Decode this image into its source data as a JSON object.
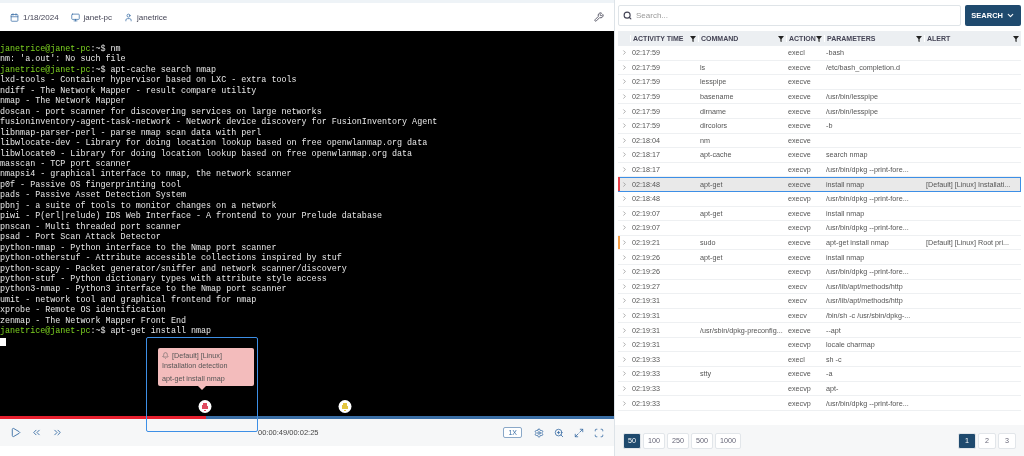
{
  "header": {
    "date": "1/18/2024",
    "host": "janet-pc",
    "user": "janetrice"
  },
  "terminal": {
    "lines": [
      {
        "kind": "prompt",
        "prompt": "janetrice@janet-pc",
        "text": ":~$ nm"
      },
      {
        "kind": "output",
        "text": "nm: 'a.out': No such file"
      },
      {
        "kind": "prompt",
        "prompt": "janetrice@janet-pc",
        "text": ":~$ apt-cache search nmap"
      },
      {
        "kind": "output",
        "text": "lxd-tools - Container hypervisor based on LXC - extra tools"
      },
      {
        "kind": "output",
        "text": "ndiff - The Network Mapper - result compare utility"
      },
      {
        "kind": "output",
        "text": "nmap - The Network Mapper"
      },
      {
        "kind": "output",
        "text": "doscan - port scanner for discovering services on large networks"
      },
      {
        "kind": "output",
        "text": "fusioninventory-agent-task-network - Network device discovery for FusionInventory Agent"
      },
      {
        "kind": "output",
        "text": "libnmap-parser-perl - parse nmap scan data with perl"
      },
      {
        "kind": "output",
        "text": "libwlocate-dev - Library for doing location lookup based on free openwlanmap.org data"
      },
      {
        "kind": "output",
        "text": "libwlocate0 - Library for doing location lookup based on free openwlanmap.org data"
      },
      {
        "kind": "output",
        "text": "masscan - TCP port scanner"
      },
      {
        "kind": "output",
        "text": "nmapsi4 - graphical interface to nmap, the network scanner"
      },
      {
        "kind": "output",
        "text": "p0f - Passive OS fingerprinting tool"
      },
      {
        "kind": "output",
        "text": "pads - Passive Asset Detection System"
      },
      {
        "kind": "output",
        "text": "pbnj - a suite of tools to monitor changes on a network"
      },
      {
        "kind": "output",
        "text": "piwi - P(erl|relude) IDS Web Interface - A frontend to your Prelude database"
      },
      {
        "kind": "output",
        "text": "pnscan - Multi threaded port scanner"
      },
      {
        "kind": "output",
        "text": "psad - Port Scan Attack Detector"
      },
      {
        "kind": "output",
        "text": "python-nmap - Python interface to the Nmap port scanner"
      },
      {
        "kind": "output",
        "text": "python-otherstuf - Attribute accessible collections inspired by stuf"
      },
      {
        "kind": "output",
        "text": "python-scapy - Packet generator/sniffer and network scanner/discovery"
      },
      {
        "kind": "output",
        "text": "python-stuf - Python dictionary types with attribute style access"
      },
      {
        "kind": "output",
        "text": "python3-nmap - Python3 interface to the Nmap port scanner"
      },
      {
        "kind": "output",
        "text": "umit - network tool and graphical frontend for nmap"
      },
      {
        "kind": "output",
        "text": "xprobe - Remote OS identification"
      },
      {
        "kind": "output",
        "text": "zenmap - The Network Mapper Front End"
      },
      {
        "kind": "prompt",
        "prompt": "janetrice@janet-pc",
        "text": ":~$ apt-get install nmap"
      }
    ],
    "cursor": true
  },
  "player": {
    "markers": [
      {
        "color": "#e04a5f"
      },
      {
        "color": "#e3c53f"
      }
    ],
    "tooltip": {
      "title": "[Default] [Linux]",
      "rule": "Installation detection",
      "command": "apt-get install nmap"
    },
    "progress": {
      "level": 0.335
    },
    "time": "00:00:49/00:02:25",
    "speed": "1X"
  },
  "search": {
    "placeholder": "Search...",
    "button": "SEARCH"
  },
  "table": {
    "columns": [
      "ACTIVITY TIME",
      "COMMAND",
      "ACTION",
      "PARAMETERS",
      "ALERT"
    ],
    "rows": [
      {
        "time": "02:17:59",
        "command": "",
        "action": "execl",
        "parameters": "-bash",
        "alert": "",
        "selected": false
      },
      {
        "time": "02:17:59",
        "command": "ls",
        "action": "execve",
        "parameters": "/etc/bash_completion.d",
        "alert": "",
        "selected": false
      },
      {
        "time": "02:17:59",
        "command": "lesspipe",
        "action": "execve",
        "parameters": "",
        "alert": "",
        "selected": false
      },
      {
        "time": "02:17:59",
        "command": "basename",
        "action": "execve",
        "parameters": "/usr/bin/lesspipe",
        "alert": "",
        "selected": false
      },
      {
        "time": "02:17:59",
        "command": "dirname",
        "action": "execve",
        "parameters": "/usr/bin/lesspipe",
        "alert": "",
        "selected": false
      },
      {
        "time": "02:17:59",
        "command": "dircolors",
        "action": "execve",
        "parameters": "-b",
        "alert": "",
        "selected": false
      },
      {
        "time": "02:18:04",
        "command": "nm",
        "action": "execve",
        "parameters": "",
        "alert": "",
        "selected": false
      },
      {
        "time": "02:18:17",
        "command": "apt-cache",
        "action": "execve",
        "parameters": "search nmap",
        "alert": "",
        "selected": false
      },
      {
        "time": "02:18:17",
        "command": "",
        "action": "execvp",
        "parameters": "/usr/bin/dpkg --print-fore...",
        "alert": "",
        "selected": false
      },
      {
        "time": "02:18:48",
        "command": "apt-get",
        "action": "execve",
        "parameters": "install nmap",
        "alert": "[Default] [Linux] Installati...",
        "selected": true,
        "color": "#e8404a"
      },
      {
        "time": "02:18:48",
        "command": "",
        "action": "execvp",
        "parameters": "/usr/bin/dpkg --print-fore...",
        "alert": "",
        "selected": false
      },
      {
        "time": "02:19:07",
        "command": "apt-get",
        "action": "execve",
        "parameters": "install nmap",
        "alert": "",
        "selected": false
      },
      {
        "time": "02:19:07",
        "command": "",
        "action": "execvp",
        "parameters": "/usr/bin/dpkg --print-fore...",
        "alert": "",
        "selected": false
      },
      {
        "time": "02:19:21",
        "command": "sudo",
        "action": "execve",
        "parameters": "apt-get install nmap",
        "alert": "[Default] [Linux] Root pri...",
        "selected": false,
        "color": "#f5a04a"
      },
      {
        "time": "02:19:26",
        "command": "apt-get",
        "action": "execve",
        "parameters": "install nmap",
        "alert": "",
        "selected": false
      },
      {
        "time": "02:19:26",
        "command": "",
        "action": "execvp",
        "parameters": "/usr/bin/dpkg --print-fore...",
        "alert": "",
        "selected": false
      },
      {
        "time": "02:19:27",
        "command": "",
        "action": "execv",
        "parameters": "/usr/lib/apt/methods/http",
        "alert": "",
        "selected": false
      },
      {
        "time": "02:19:31",
        "command": "",
        "action": "execv",
        "parameters": "/usr/lib/apt/methods/http",
        "alert": "",
        "selected": false
      },
      {
        "time": "02:19:31",
        "command": "",
        "action": "execv",
        "parameters": "/bin/sh -c /usr/sbin/dpkg-...",
        "alert": "",
        "selected": false
      },
      {
        "time": "02:19:31",
        "command": "/usr/sbin/dpkg-preconfig...",
        "action": "execve",
        "parameters": "--apt",
        "alert": "",
        "selected": false
      },
      {
        "time": "02:19:31",
        "command": "",
        "action": "execvp",
        "parameters": "locale charmap",
        "alert": "",
        "selected": false
      },
      {
        "time": "02:19:33",
        "command": "",
        "action": "execl",
        "parameters": "sh -c",
        "alert": "",
        "selected": false
      },
      {
        "time": "02:19:33",
        "command": "stty",
        "action": "execve",
        "parameters": "-a",
        "alert": "",
        "selected": false
      },
      {
        "time": "02:19:33",
        "command": "",
        "action": "execvp",
        "parameters": "apt-",
        "alert": "",
        "selected": false
      },
      {
        "time": "02:19:33",
        "command": "",
        "action": "execvp",
        "parameters": "/usr/bin/dpkg --print-fore...",
        "alert": "",
        "selected": false
      }
    ]
  },
  "pagination": {
    "page_sizes": [
      {
        "label": "50",
        "selected": true
      },
      {
        "label": "100",
        "selected": false
      },
      {
        "label": "250",
        "selected": false
      },
      {
        "label": "500",
        "selected": false
      },
      {
        "label": "1000",
        "selected": false
      }
    ],
    "pages": [
      {
        "label": "1",
        "selected": true
      },
      {
        "label": "2",
        "selected": false
      },
      {
        "label": "3",
        "selected": false
      }
    ]
  }
}
